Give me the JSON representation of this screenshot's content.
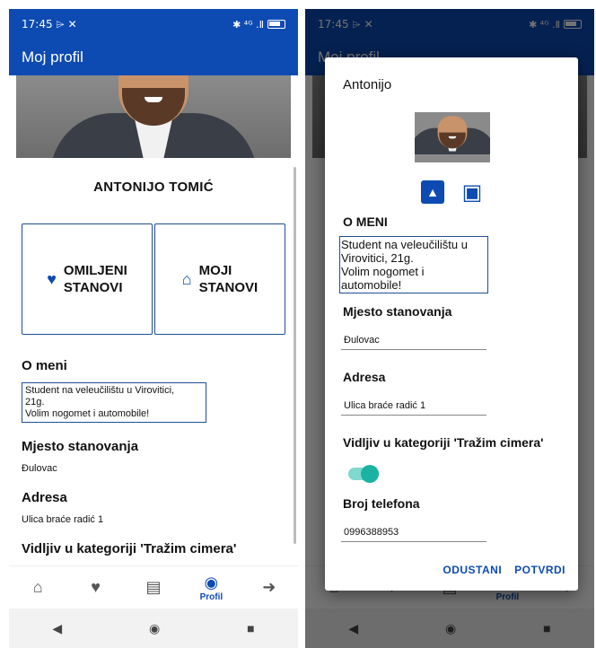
{
  "status": {
    "time": "17:45",
    "time_icons": "⌲ ✕",
    "right": "✱ ⁴ᴳ .Ⅱ"
  },
  "appbar": {
    "title": "Moj profil"
  },
  "profile": {
    "name": "ANTONIJO TOMIĆ",
    "favorites_label_1": "OMILJENI",
    "favorites_label_2": "STANOVI",
    "my_label_1": "MOJI",
    "my_label_2": "STANOVI",
    "about_title": "O meni",
    "about_lines": [
      "Student na veleučilištu u Virovitici,",
      "21g.",
      "Volim nogomet i automobile!"
    ],
    "residence_title": "Mjesto stanovanja",
    "residence": "Đulovac",
    "address_title": "Adresa",
    "address": "Ulica braće radić 1",
    "visible_title": "Vidljiv u kategoriji 'Tražim cimera'",
    "visible": false
  },
  "nav": {
    "items": [
      "home-icon",
      "heart-icon",
      "chat-icon",
      "profile-icon",
      "logout-icon"
    ],
    "active_label": "Profil"
  },
  "dialog": {
    "title": "Antonijo",
    "about_title": "O MENI",
    "about_lines": [
      "Student na veleučilištu u",
      "Virovitici, 21g.",
      "Volim nogomet i",
      "automobile!"
    ],
    "residence_title": "Mjesto stanovanja",
    "residence": "Đulovac",
    "address_title": "Adresa",
    "address": "Ulica braće radić 1",
    "visible_title": "Vidljiv u kategoriji 'Tražim cimera'",
    "visible": true,
    "phone_title": "Broj telefona",
    "phone": "0996388953",
    "cancel": "ODUSTANI",
    "confirm": "POTVRDI"
  },
  "colors": {
    "primary": "#0d4bb3",
    "toggle_on": "#1ab3a3"
  }
}
